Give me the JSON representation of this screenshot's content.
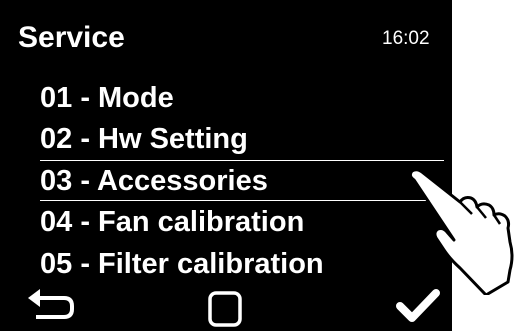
{
  "header": {
    "title": "Service",
    "time": "16:02"
  },
  "menu": {
    "items": [
      {
        "label": "01 - Mode"
      },
      {
        "label": "02 - Hw Setting"
      },
      {
        "label": "03 - Accessories",
        "selected": true
      },
      {
        "label": "04 - Fan calibration"
      },
      {
        "label": "05 - Filter calibration"
      }
    ]
  },
  "bottom_bar": {
    "back_icon": "back-arrow-icon",
    "home_icon": "square-icon",
    "confirm_icon": "checkmark-icon"
  },
  "overlay": {
    "pointer_icon": "pointing-hand-icon"
  },
  "colors": {
    "screen_bg": "#000000",
    "text": "#ffffff",
    "page_bg": "#ffffff"
  }
}
